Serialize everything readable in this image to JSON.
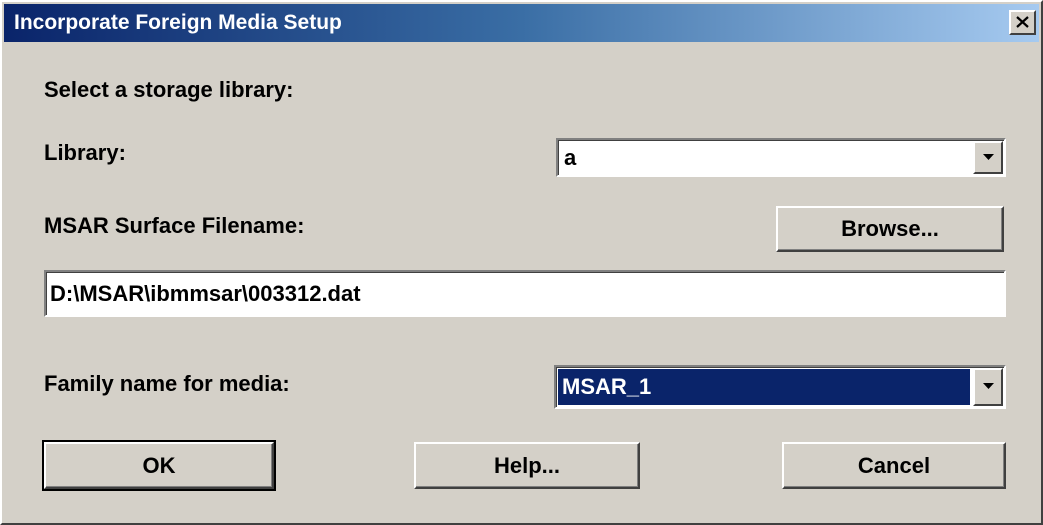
{
  "window": {
    "title": "Incorporate Foreign Media Setup"
  },
  "labels": {
    "select_library": "Select a storage library:",
    "library": "Library:",
    "msar_surface_filename": "MSAR Surface Filename:",
    "family_name": "Family name for media:"
  },
  "library_combo": {
    "selected": "a"
  },
  "filename_field": {
    "value": "D:\\MSAR\\ibmmsar\\003312.dat"
  },
  "family_combo": {
    "selected": "MSAR_1"
  },
  "buttons": {
    "browse": "Browse...",
    "ok": "OK",
    "help": "Help...",
    "cancel": "Cancel"
  },
  "icons": {
    "close": "close-icon",
    "dropdown": "chevron-down-icon"
  },
  "colors": {
    "titlebar_start": "#0a246a",
    "titlebar_end": "#a6caf0",
    "face": "#d4d0c8",
    "selection": "#0a246a"
  }
}
